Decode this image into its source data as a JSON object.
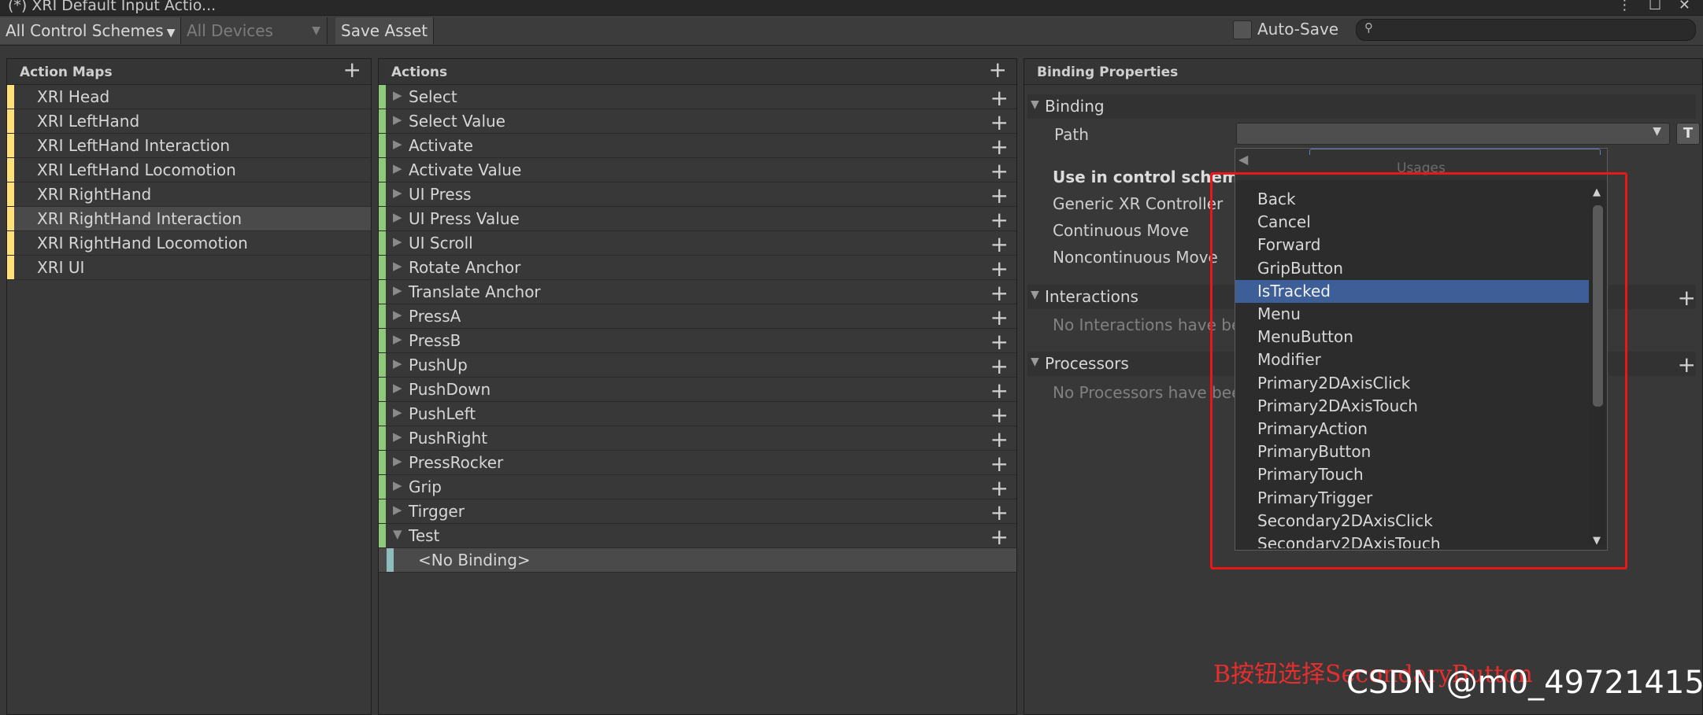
{
  "window": {
    "tab_title": "(*) XRI Default Input Actio...",
    "controls": "⋮ ☐ ✕"
  },
  "toolbar": {
    "control_schemes": "All Control Schemes",
    "devices": "All Devices",
    "save_asset": "Save Asset",
    "auto_save": "Auto-Save",
    "search_value": ""
  },
  "action_maps": {
    "title": "Action Maps",
    "items": [
      {
        "label": "XRI Head",
        "selected": false
      },
      {
        "label": "XRI LeftHand",
        "selected": false
      },
      {
        "label": "XRI LeftHand Interaction",
        "selected": false
      },
      {
        "label": "XRI LeftHand Locomotion",
        "selected": false
      },
      {
        "label": "XRI RightHand",
        "selected": false
      },
      {
        "label": "XRI RightHand Interaction",
        "selected": true
      },
      {
        "label": "XRI RightHand Locomotion",
        "selected": false
      },
      {
        "label": "XRI UI",
        "selected": false
      }
    ]
  },
  "actions": {
    "title": "Actions",
    "items": [
      {
        "label": "Select",
        "expanded": false
      },
      {
        "label": "Select Value",
        "expanded": false
      },
      {
        "label": "Activate",
        "expanded": false
      },
      {
        "label": "Activate Value",
        "expanded": false
      },
      {
        "label": "UI Press",
        "expanded": false
      },
      {
        "label": "UI Press Value",
        "expanded": false
      },
      {
        "label": "UI Scroll",
        "expanded": false
      },
      {
        "label": "Rotate Anchor",
        "expanded": false
      },
      {
        "label": "Translate Anchor",
        "expanded": false
      },
      {
        "label": "PressA",
        "expanded": false
      },
      {
        "label": "PressB",
        "expanded": false
      },
      {
        "label": "PushUp",
        "expanded": false
      },
      {
        "label": "PushDown",
        "expanded": false
      },
      {
        "label": "PushLeft",
        "expanded": false
      },
      {
        "label": "PushRight",
        "expanded": false
      },
      {
        "label": "PressRocker",
        "expanded": false
      },
      {
        "label": "Grip",
        "expanded": false
      },
      {
        "label": "Tirgger",
        "expanded": false
      },
      {
        "label": "Test",
        "expanded": true
      }
    ],
    "binding_child": "<No Binding>"
  },
  "binding_properties": {
    "title": "Binding Properties",
    "binding_section": "Binding",
    "path_label": "Path",
    "t_button": "T",
    "use_in_control_scheme": "Use in control scheme",
    "schemes": [
      "Generic XR Controller",
      "Continuous Move",
      "Noncontinuous Move"
    ],
    "interactions_section": "Interactions",
    "interactions_empty": "No Interactions have bee",
    "processors_section": "Processors",
    "processors_empty": "No Processors have bee"
  },
  "path_dropdown": {
    "header_label": "Usages",
    "highlighted": "IsTracked",
    "items": [
      "Back",
      "Cancel",
      "Forward",
      "GripButton",
      "IsTracked",
      "Menu",
      "MenuButton",
      "Modifier",
      "Primary2DAxisClick",
      "Primary2DAxisTouch",
      "PrimaryAction",
      "PrimaryButton",
      "PrimaryTouch",
      "PrimaryTrigger",
      "Secondary2DAxisClick",
      "Secondary2DAxisTouch"
    ]
  },
  "annotation": {
    "text": "B按钮选择SecondaryButton",
    "color": "#e62e2e"
  },
  "watermark": "CSDN @m0_49721415",
  "colors": {
    "action_map_stripe": "#ffe07a",
    "action_stripe": "#8fc97a",
    "binding_stripe": "#8fbcbc",
    "highlight": "#3d5e97",
    "red_box": "#e81818"
  }
}
